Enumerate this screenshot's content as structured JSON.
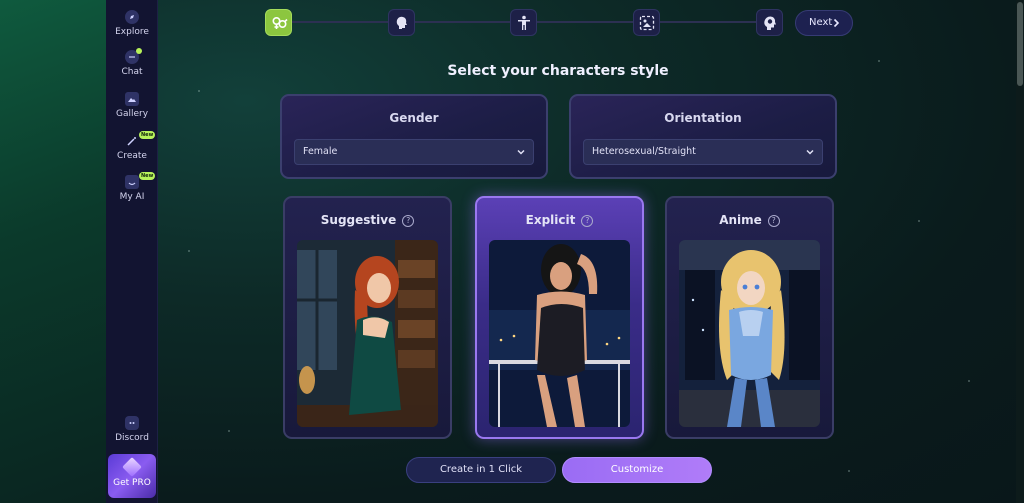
{
  "sidebar": {
    "items": [
      {
        "label": "Explore",
        "icon": "compass-icon"
      },
      {
        "label": "Chat",
        "icon": "chat-bubble-icon"
      },
      {
        "label": "Gallery",
        "icon": "image-icon"
      },
      {
        "label": "Create",
        "icon": "magic-wand-icon",
        "badge": "New"
      },
      {
        "label": "My AI",
        "icon": "heart-face-icon",
        "badge": "New"
      },
      {
        "label": "Discord",
        "icon": "discord-icon"
      }
    ],
    "get_pro_label": "Get PRO"
  },
  "stepper": {
    "steps": [
      {
        "icon": "gender-symbols-icon",
        "active": true
      },
      {
        "icon": "head-profile-icon",
        "active": false
      },
      {
        "icon": "body-figure-icon",
        "active": false
      },
      {
        "icon": "scene-frame-icon",
        "active": false
      },
      {
        "icon": "brain-head-icon",
        "active": false
      }
    ],
    "next_label": "Next"
  },
  "heading": "Select your characters style",
  "gender": {
    "label": "Gender",
    "value": "Female"
  },
  "orientation": {
    "label": "Orientation",
    "value": "Heterosexual/Straight"
  },
  "styles": [
    {
      "title": "Suggestive",
      "selected": false
    },
    {
      "title": "Explicit",
      "selected": true
    },
    {
      "title": "Anime",
      "selected": false
    }
  ],
  "help_glyph": "?",
  "actions": {
    "quick": "Create in 1 Click",
    "customize": "Customize"
  },
  "colors": {
    "accent": "#9a6cf4",
    "active_step": "#8cc63f",
    "badge": "#b7f25a"
  }
}
